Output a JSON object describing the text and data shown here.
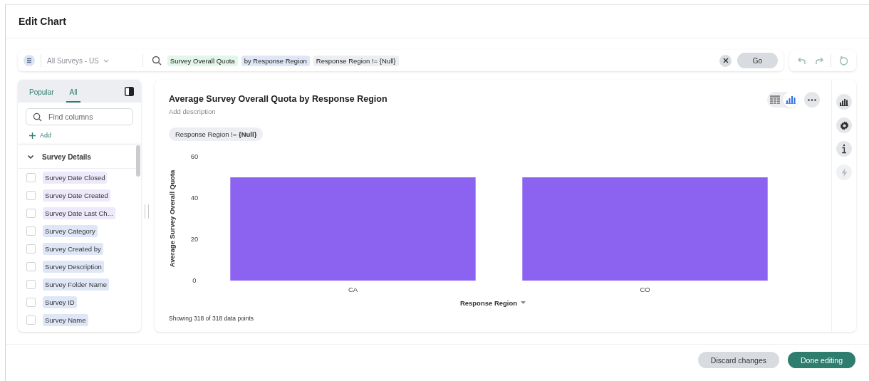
{
  "window": {
    "title": "Edit Chart"
  },
  "query_bar": {
    "source": "All Surveys - US",
    "tokens": [
      {
        "text": "Survey Overall Quota",
        "kind": "measure"
      },
      {
        "text": "by Response Region",
        "kind": "attribute"
      },
      {
        "text": "Response Region != {Null}",
        "kind": "filter"
      }
    ],
    "go": "Go"
  },
  "sidebar": {
    "tabs": [
      {
        "label": "Popular",
        "selected": false
      },
      {
        "label": "All",
        "selected": true
      }
    ],
    "search": {
      "placeholder": "Find columns"
    },
    "add": "Add",
    "group": {
      "label": "Survey Details",
      "expanded": true
    },
    "items": [
      {
        "label": "Survey Date Closed",
        "checked": false,
        "color": "#ede9fb"
      },
      {
        "label": "Survey Date Created",
        "checked": false,
        "color": "#ede9fb"
      },
      {
        "label": "Survey Date Last Ch...",
        "checked": false,
        "color": "#ede9fb"
      },
      {
        "label": "Survey Category",
        "checked": false,
        "color": "#dfe7f7"
      },
      {
        "label": "Survey Created by",
        "checked": false,
        "color": "#dfe7f7"
      },
      {
        "label": "Survey Description",
        "checked": false,
        "color": "#dfe7f7"
      },
      {
        "label": "Survey Folder Name",
        "checked": false,
        "color": "#dfe7f7"
      },
      {
        "label": "Survey ID",
        "checked": false,
        "color": "#dfe7f7"
      },
      {
        "label": "Survey Name",
        "checked": false,
        "color": "#dfe7f7"
      }
    ]
  },
  "chart_card": {
    "title": "Average Survey Overall Quota by Response Region",
    "description": "Add description",
    "filter_chip": "Response Region != **{Null}**",
    "views": [
      {
        "kind": "table",
        "selected": false
      },
      {
        "kind": "chart",
        "selected": true
      }
    ],
    "chart_data": {
      "type": "bar",
      "xlabel": "Response Region",
      "ylabel": "Average Survey Overall Quota",
      "categories": [
        "CA",
        "CO"
      ],
      "series": [
        {
          "color": "#8b63f0",
          "values": [
            50,
            50
          ]
        }
      ],
      "ylim": [
        0,
        60
      ],
      "yticks": [
        0,
        20,
        40,
        60
      ]
    },
    "footnote": "Showing 318 of 318 data points",
    "rail": [
      {
        "kind": "chart",
        "disabled": false
      },
      {
        "kind": "settings",
        "disabled": false
      },
      {
        "kind": "info",
        "disabled": false
      },
      {
        "kind": "bolt",
        "disabled": true
      }
    ]
  },
  "footer": {
    "buttons": [
      {
        "label": "Discard changes",
        "kind": "secondary"
      },
      {
        "label": "Done editing",
        "kind": "primary"
      }
    ]
  }
}
